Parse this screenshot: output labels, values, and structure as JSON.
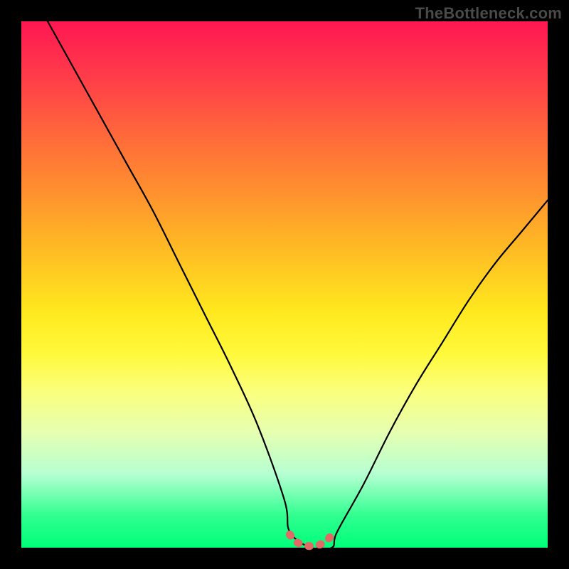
{
  "watermark": "TheBottleneck.com",
  "colors": {
    "frame": "#000000",
    "curve": "#000000",
    "marker": "#e06a66",
    "gradient_top": "#ff1752",
    "gradient_bottom": "#00ff7a"
  },
  "chart_data": {
    "type": "line",
    "title": "",
    "xlabel": "",
    "ylabel": "",
    "xlim": [
      0,
      100
    ],
    "ylim": [
      0,
      100
    ],
    "grid": false,
    "legend": false,
    "series": [
      {
        "name": "bottleneck-curve",
        "x": [
          5,
          10,
          15,
          20,
          25,
          30,
          35,
          40,
          45,
          50,
          51,
          55,
          59,
          60,
          65,
          70,
          75,
          80,
          85,
          90,
          95,
          100
        ],
        "values": [
          100,
          91,
          82,
          73,
          64,
          54,
          44,
          34,
          23,
          9,
          3,
          0,
          0,
          3,
          12,
          22,
          31,
          39,
          47,
          54,
          60,
          66
        ]
      },
      {
        "name": "optimal-marker",
        "x": [
          51,
          52,
          53,
          54,
          55,
          56,
          57,
          58,
          59
        ],
        "values": [
          2.5,
          1.3,
          0.7,
          0.4,
          0.3,
          0.4,
          0.7,
          1.3,
          2.5
        ]
      }
    ],
    "notes": "Values estimated from pixel positions; y is percent bottleneck (0 at bottom, 100 at top), x is relative component performance. Minimum (optimal) region ≈ x 51–59."
  }
}
